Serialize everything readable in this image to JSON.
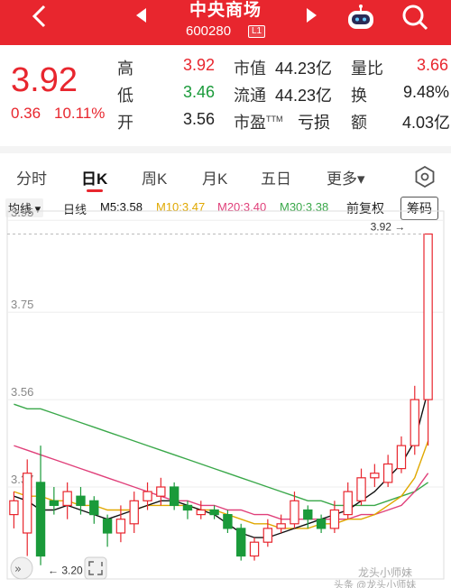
{
  "header": {
    "title": "中央商场",
    "code": "600280",
    "level_badge": "L1"
  },
  "quote": {
    "price": "3.92",
    "change": "0.36",
    "change_pct": "10.11%",
    "high_label": "高",
    "high": "3.92",
    "low_label": "低",
    "low": "3.46",
    "open_label": "开",
    "open": "3.56",
    "mktcap_label": "市值",
    "mktcap": "44.23亿",
    "float_label": "流通",
    "float": "44.23亿",
    "pe_label": "市盈",
    "pe_tm": "TTM",
    "pe": "亏损",
    "volratio_label": "量比",
    "volratio": "3.66",
    "turnover_label": "换",
    "turnover": "9.48%",
    "amount_label": "额",
    "amount": "4.03亿"
  },
  "tabs": [
    "分时",
    "日K",
    "周K",
    "月K",
    "五日",
    "更多▾"
  ],
  "ma_legend": {
    "mode": "均线 ▾",
    "daily": "日线",
    "m5": "M5:3.58",
    "m10": "M10:3.47",
    "m20": "M20:3.40",
    "m30": "M30:3.38",
    "adjust": "前复权",
    "chips": "筹码"
  },
  "colors": {
    "up": "#e8262e",
    "down": "#1a9a3a",
    "m5": "#111111",
    "m10": "#e0a800",
    "m20": "#e0407a",
    "m30": "#3aa84a"
  },
  "chart_data": {
    "type": "candlestick",
    "y_ticks": [
      "3.95",
      "3.75",
      "3.56",
      "3.37"
    ],
    "ylim": [
      3.17,
      3.97
    ],
    "max_label": "3.92",
    "min_label": "3.20",
    "candles": [
      {
        "o": 3.31,
        "c": 3.34,
        "h": 3.36,
        "l": 3.28
      },
      {
        "o": 3.27,
        "c": 3.4,
        "h": 3.43,
        "l": 3.22
      },
      {
        "o": 3.38,
        "c": 3.22,
        "h": 3.46,
        "l": 3.2
      },
      {
        "o": 3.34,
        "c": 3.33,
        "h": 3.37,
        "l": 3.31
      },
      {
        "o": 3.33,
        "c": 3.36,
        "h": 3.38,
        "l": 3.3
      },
      {
        "o": 3.35,
        "c": 3.33,
        "h": 3.37,
        "l": 3.31
      },
      {
        "o": 3.34,
        "c": 3.31,
        "h": 3.35,
        "l": 3.29
      },
      {
        "o": 3.3,
        "c": 3.27,
        "h": 3.31,
        "l": 3.24
      },
      {
        "o": 3.27,
        "c": 3.3,
        "h": 3.33,
        "l": 3.25
      },
      {
        "o": 3.29,
        "c": 3.34,
        "h": 3.36,
        "l": 3.27
      },
      {
        "o": 3.34,
        "c": 3.36,
        "h": 3.38,
        "l": 3.32
      },
      {
        "o": 3.35,
        "c": 3.37,
        "h": 3.39,
        "l": 3.33
      },
      {
        "o": 3.37,
        "c": 3.33,
        "h": 3.38,
        "l": 3.32
      },
      {
        "o": 3.33,
        "c": 3.32,
        "h": 3.34,
        "l": 3.3
      },
      {
        "o": 3.31,
        "c": 3.32,
        "h": 3.34,
        "l": 3.3
      },
      {
        "o": 3.32,
        "c": 3.31,
        "h": 3.33,
        "l": 3.3
      },
      {
        "o": 3.31,
        "c": 3.28,
        "h": 3.32,
        "l": 3.27
      },
      {
        "o": 3.28,
        "c": 3.22,
        "h": 3.29,
        "l": 3.21
      },
      {
        "o": 3.22,
        "c": 3.25,
        "h": 3.26,
        "l": 3.21
      },
      {
        "o": 3.25,
        "c": 3.28,
        "h": 3.3,
        "l": 3.24
      },
      {
        "o": 3.28,
        "c": 3.29,
        "h": 3.31,
        "l": 3.27
      },
      {
        "o": 3.29,
        "c": 3.34,
        "h": 3.36,
        "l": 3.28
      },
      {
        "o": 3.32,
        "c": 3.3,
        "h": 3.33,
        "l": 3.28
      },
      {
        "o": 3.3,
        "c": 3.28,
        "h": 3.31,
        "l": 3.27
      },
      {
        "o": 3.28,
        "c": 3.32,
        "h": 3.34,
        "l": 3.27
      },
      {
        "o": 3.31,
        "c": 3.36,
        "h": 3.38,
        "l": 3.3
      },
      {
        "o": 3.34,
        "c": 3.39,
        "h": 3.41,
        "l": 3.33
      },
      {
        "o": 3.39,
        "c": 3.4,
        "h": 3.42,
        "l": 3.37
      },
      {
        "o": 3.38,
        "c": 3.42,
        "h": 3.44,
        "l": 3.37
      },
      {
        "o": 3.41,
        "c": 3.46,
        "h": 3.48,
        "l": 3.4
      },
      {
        "o": 3.46,
        "c": 3.56,
        "h": 3.59,
        "l": 3.44
      },
      {
        "o": 3.56,
        "c": 3.92,
        "h": 3.92,
        "l": 3.46
      }
    ],
    "ma5": [
      3.35,
      3.34,
      3.32,
      3.32,
      3.33,
      3.32,
      3.31,
      3.3,
      3.31,
      3.32,
      3.33,
      3.34,
      3.34,
      3.33,
      3.32,
      3.31,
      3.29,
      3.27,
      3.26,
      3.26,
      3.27,
      3.28,
      3.29,
      3.3,
      3.31,
      3.32,
      3.34,
      3.36,
      3.39,
      3.42,
      3.47,
      3.58
    ],
    "ma10": [
      3.36,
      3.35,
      3.35,
      3.34,
      3.34,
      3.33,
      3.33,
      3.32,
      3.32,
      3.32,
      3.33,
      3.33,
      3.33,
      3.33,
      3.32,
      3.32,
      3.31,
      3.3,
      3.29,
      3.29,
      3.28,
      3.28,
      3.28,
      3.29,
      3.29,
      3.3,
      3.3,
      3.31,
      3.33,
      3.35,
      3.39,
      3.47
    ],
    "ma20": [
      3.46,
      3.45,
      3.44,
      3.43,
      3.42,
      3.41,
      3.4,
      3.39,
      3.38,
      3.37,
      3.36,
      3.35,
      3.34,
      3.34,
      3.33,
      3.33,
      3.32,
      3.32,
      3.31,
      3.31,
      3.3,
      3.3,
      3.3,
      3.3,
      3.3,
      3.3,
      3.31,
      3.31,
      3.32,
      3.33,
      3.36,
      3.4
    ],
    "ma30": [
      3.55,
      3.54,
      3.54,
      3.53,
      3.52,
      3.51,
      3.5,
      3.49,
      3.48,
      3.47,
      3.46,
      3.45,
      3.44,
      3.43,
      3.42,
      3.41,
      3.4,
      3.39,
      3.38,
      3.37,
      3.36,
      3.35,
      3.34,
      3.34,
      3.33,
      3.33,
      3.33,
      3.33,
      3.34,
      3.35,
      3.36,
      3.38
    ]
  },
  "watermark": "龙头小师妹",
  "watermark_sub": "头条 @龙头小师妹"
}
